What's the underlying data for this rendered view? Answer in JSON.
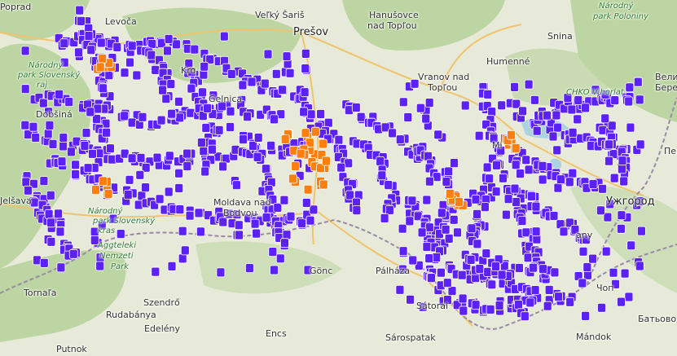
{
  "map": {
    "labels": {
      "poprad": "Poprad",
      "levoca": "Levoča",
      "velky_saris": "Veľký Šariš",
      "presov": "Prešov",
      "hanusovce_1": "Hanušovce",
      "hanusovce_2": "nad Topľou",
      "snina": "Snina",
      "humenne": "Humenné",
      "vranov_1": "Vranov nad",
      "vranov_2": "Topľou",
      "park_slovensky_1": "Národný",
      "park_slovensky_2": "park Slovenský",
      "park_slovensky_3": "raj",
      "park_poloniny_1": "Národný",
      "park_poloniny_2": "park Poloniny",
      "chko_vihorlat": "CHKO Vihorlat",
      "velik": "Велик",
      "berez": "Березн",
      "kro": "Kro",
      "gelnica": "Gelnica",
      "dobsina": "Dobšiná",
      "jelsava": "Jelšava",
      "park_kras_1": "Národný",
      "park_kras_2": "park Slovenský",
      "park_kras_3": "kras",
      "aggtelek_1": "Aggteleki",
      "aggtelek_2": "Nemzeti",
      "aggtelek_3": "Park",
      "moldava_1": "Moldava nad",
      "moldava_2": "Bodvou",
      "michalovce": "Mi",
      "uzhgorod": "Ужгород",
      "pere": "Пере",
      "any": "any",
      "gonc": "Gönc",
      "palhaza": "Pálháza",
      "sator": "Sátoral",
      "tornala": "Tornaľa",
      "szendro": "Szendrő",
      "rudabanya": "Rudabánya",
      "edeleny": "Edelény",
      "encs": "Encs",
      "sarospatak": "Sárospatak",
      "putnok": "Putnok",
      "chop": "Чоп",
      "batyovo": "Батьово",
      "mandok": "Mándok",
      "vit": "vit"
    },
    "colors": {
      "background": "#e8ead9",
      "forest": "#b7d39c",
      "border": "#9a8aa6",
      "road": "#f0c36c",
      "stop_marker": "#5b21f5",
      "highlight_marker": "#ff7f0e",
      "water": "#aad3df"
    },
    "marker_icon": "bus-stop-icon",
    "highlight_icon": "bus-stop-highlight-icon"
  }
}
